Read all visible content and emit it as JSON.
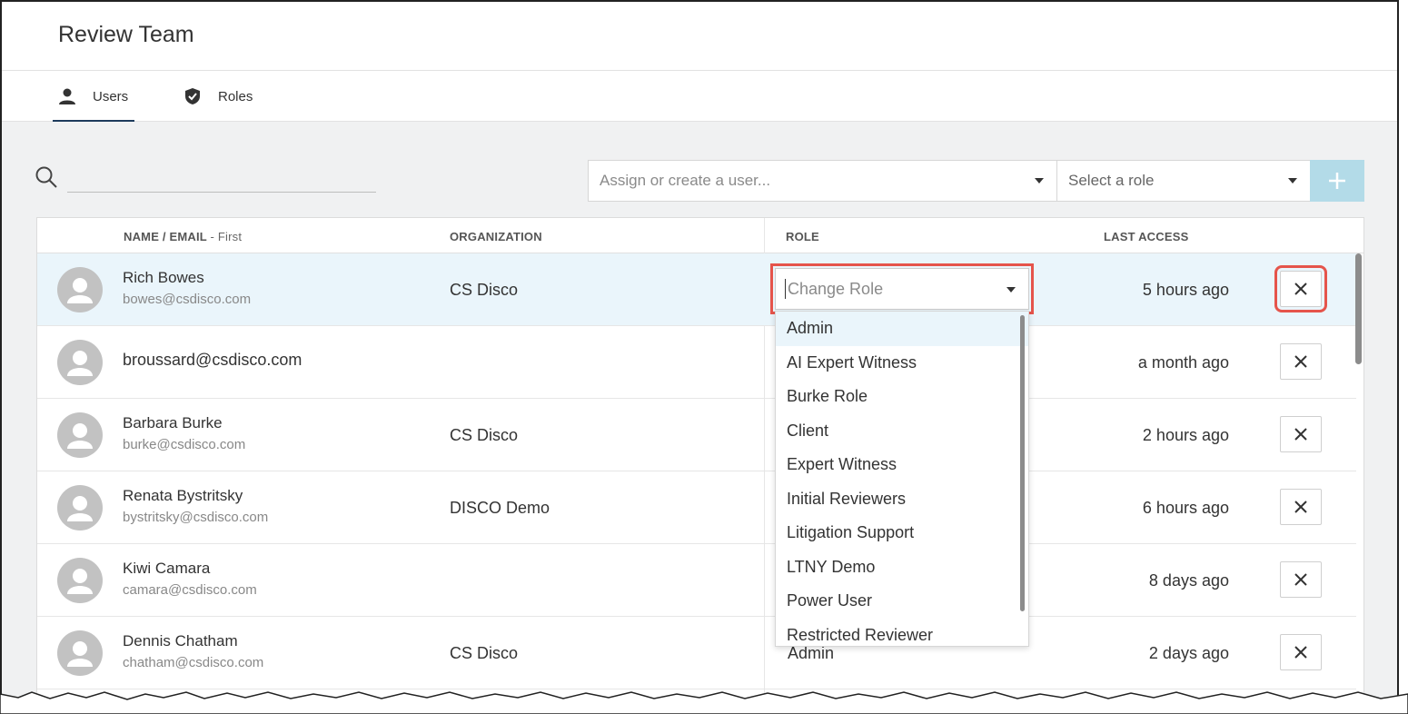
{
  "header": {
    "title": "Review Team"
  },
  "tabs": [
    {
      "label": "Users",
      "icon": "user-icon",
      "active": true
    },
    {
      "label": "Roles",
      "icon": "shield-check-icon",
      "active": false
    }
  ],
  "toolbar": {
    "search_placeholder": "",
    "assign_placeholder": "Assign or create a user...",
    "role_placeholder": "Select a role",
    "add_icon": "plus-icon"
  },
  "table": {
    "columns": {
      "name": "NAME / EMAIL",
      "name_sort": "- First",
      "organization": "ORGANIZATION",
      "role": "ROLE",
      "last_access": "LAST ACCESS"
    },
    "rows": [
      {
        "name": "Rich Bowes",
        "email": "bowes@csdisco.com",
        "organization": "CS Disco",
        "role": "",
        "last_access": "5 hours ago",
        "selected": true
      },
      {
        "name": "",
        "email": "broussard@csdisco.com",
        "organization": "",
        "role": "",
        "last_access": "a month ago"
      },
      {
        "name": "Barbara Burke",
        "email": "burke@csdisco.com",
        "organization": "CS Disco",
        "role": "",
        "last_access": "2 hours ago"
      },
      {
        "name": "Renata Bystritsky",
        "email": "bystritsky@csdisco.com",
        "organization": "DISCO Demo",
        "role": "",
        "last_access": "6 hours ago"
      },
      {
        "name": "Kiwi Camara",
        "email": "camara@csdisco.com",
        "organization": "",
        "role": "",
        "last_access": "8 days ago"
      },
      {
        "name": "Dennis Chatham",
        "email": "chatham@csdisco.com",
        "organization": "CS Disco",
        "role": "Admin",
        "last_access": "2 days ago"
      }
    ]
  },
  "role_select": {
    "placeholder": "Change Role",
    "options": [
      "Admin",
      "AI Expert Witness",
      "Burke Role",
      "Client",
      "Expert Witness",
      "Initial Reviewers",
      "Litigation Support",
      "LTNY Demo",
      "Power User",
      "Restricted Reviewer"
    ],
    "highlighted_index": 0
  },
  "colors": {
    "accent": "#1d3b5c",
    "highlight_outline": "#e5544b",
    "add_button": "#b3dbe8",
    "selected_row": "#eaf5fb"
  }
}
